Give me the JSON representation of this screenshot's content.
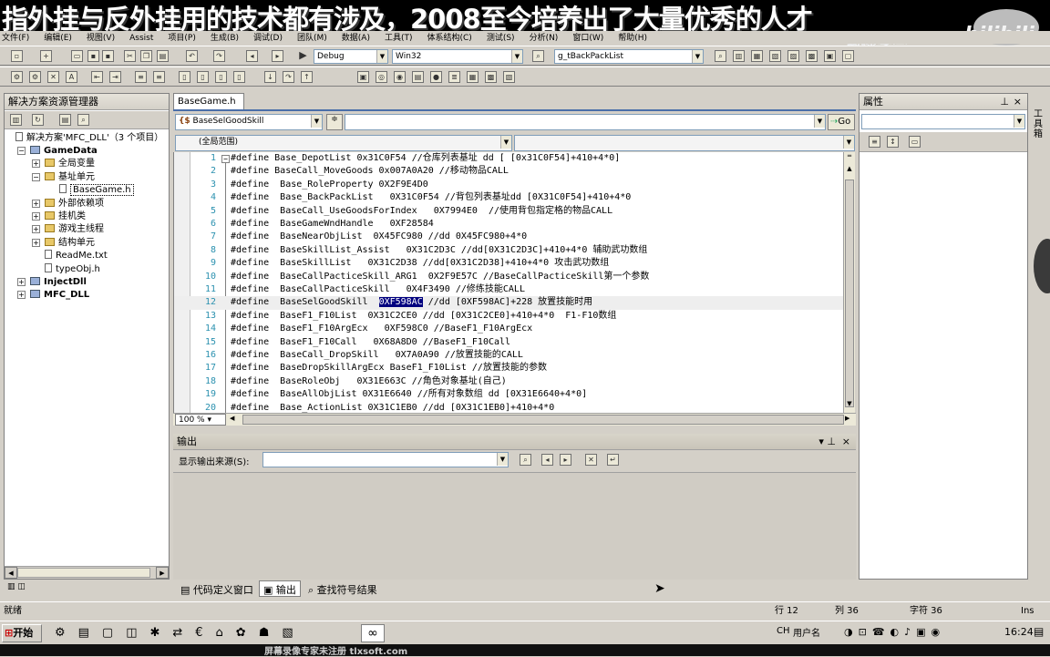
{
  "banner": {
    "text": "指外挂与反外挂用的技术都有涉及，2008至今培养出了大量优秀的人才",
    "watermark": "教你学会",
    "logo": "bilibili"
  },
  "menu": [
    "文件(F)",
    "编辑(E)",
    "视图(V)",
    "Assist",
    "项目(P)",
    "生成(B)",
    "调试(D)",
    "团队(M)",
    "数据(A)",
    "工具(T)",
    "体系结构(C)",
    "测试(S)",
    "分析(N)",
    "窗口(W)",
    "帮助(H)"
  ],
  "toolbar": {
    "config": "Debug",
    "platform": "Win32",
    "find": "g_tBackPackList"
  },
  "solution_explorer": {
    "title": "解决方案资源管理器",
    "root": "解决方案'MFC_DLL'（3 个项目）",
    "items": [
      {
        "label": "GameData",
        "indent": 1,
        "type": "project",
        "expanded": true
      },
      {
        "label": "全局变量",
        "indent": 2,
        "type": "folder",
        "expanded": false
      },
      {
        "label": "基址单元",
        "indent": 2,
        "type": "folder",
        "expanded": true
      },
      {
        "label": "BaseGame.h",
        "indent": 3,
        "type": "file",
        "selected": true
      },
      {
        "label": "外部依赖项",
        "indent": 2,
        "type": "folder",
        "expanded": false
      },
      {
        "label": "挂机类",
        "indent": 2,
        "type": "folder",
        "expanded": false
      },
      {
        "label": "游戏主线程",
        "indent": 2,
        "type": "folder",
        "expanded": false
      },
      {
        "label": "结构单元",
        "indent": 2,
        "type": "folder",
        "expanded": false
      },
      {
        "label": "ReadMe.txt",
        "indent": 2,
        "type": "file"
      },
      {
        "label": "typeObj.h",
        "indent": 2,
        "type": "file"
      },
      {
        "label": "InjectDll",
        "indent": 1,
        "type": "project",
        "expanded": false
      },
      {
        "label": "MFC_DLL",
        "indent": 1,
        "type": "project",
        "expanded": false
      }
    ]
  },
  "editor": {
    "tab": "BaseGame.h",
    "context_combo": "BaseSelGoodSkill",
    "go_label": "Go",
    "scope": "(全局范围)",
    "zoom": "100 %",
    "lines": [
      {
        "n": "1",
        "pre": "#define Base_DepotList 0x31C0F54 ",
        "cm": "//仓库列表基址 dd [ [0x31C0F54]+410+4*0]"
      },
      {
        "n": "2",
        "pre": "#define BaseCall_MoveGoods 0x007A0A20 ",
        "cm": "//移动物品CALL"
      },
      {
        "n": "3",
        "pre": "#define  Base_RoleProperty 0X2F9E4D0",
        "cm": ""
      },
      {
        "n": "4",
        "pre": "#define  Base_BackPackList   0X31C0F54 ",
        "cm": "//背包列表基址dd [0X31C0F54]+410+4*0"
      },
      {
        "n": "5",
        "pre": "#define  BaseCall_UseGoodsForIndex   0X7994E0  ",
        "cm": "//使用背包指定格的物品CALL"
      },
      {
        "n": "6",
        "pre": "#define  BaseGameWndHandle   0XF28584",
        "cm": ""
      },
      {
        "n": "7",
        "pre": "#define  BaseNearObjList  0X45FC980 ",
        "cm": "//dd 0X45FC980+4*0"
      },
      {
        "n": "8",
        "pre": "#define  BaseSkillList_Assist   0X31C2D3C ",
        "cm": "//dd[0X31C2D3C]+410+4*0 辅助武功数组"
      },
      {
        "n": "9",
        "pre": "#define  BaseSkillList   0X31C2D38 ",
        "cm": "//dd[0X31C2D38]+410+4*0 攻击武功数组"
      },
      {
        "n": "10",
        "pre": "#define  BaseCallPacticeSkill_ARG1  0X2F9E57C ",
        "cm": "//BaseCallPacticeSkill第一个参数"
      },
      {
        "n": "11",
        "pre": "#define  BaseCallPacticeSkill   0X4F3490 ",
        "cm": "//修练技能CALL"
      },
      {
        "n": "12",
        "pre": "#define  BaseSelGoodSkill  ",
        "hl": "0XF598AC",
        "cm": " //dd [0XF598AC]+228 放置技能时用"
      },
      {
        "n": "13",
        "pre": "#define  BaseF1_F10List  0X31C2CE0 ",
        "cm": "//dd [0X31C2CE0]+410+4*0  F1-F10数组"
      },
      {
        "n": "14",
        "pre": "#define  BaseF1_F10ArgEcx   0XF598C0 ",
        "cm": "//BaseF1_F10ArgEcx"
      },
      {
        "n": "15",
        "pre": "#define  BaseF1_F10Call   0X68A8D0 ",
        "cm": "//BaseF1_F10Call"
      },
      {
        "n": "16",
        "pre": "#define  BaseCall_DropSkill   0X7A0A90 ",
        "cm": "//放置技能的CALL"
      },
      {
        "n": "17",
        "pre": "#define  BaseDropSkillArgEcx BaseF1_F10List ",
        "cm": "//放置技能的参数"
      },
      {
        "n": "18",
        "pre": "#define  BaseRoleObj   0X31E663C ",
        "cm": "//角色对象基址(自己)"
      },
      {
        "n": "19",
        "pre": "#define  BaseAllObjList 0X31E6640 ",
        "cm": "//所有对象数组 dd [0X31E6640+4*0]"
      },
      {
        "n": "20",
        "pre": "#define  Base_ActionList 0X31C1EB0 ",
        "cm": "//dd [0X31C1EB0]+410+4*0"
      }
    ]
  },
  "output": {
    "title": "输出",
    "source_label": "显示输出来源(S):"
  },
  "properties": {
    "title": "属性"
  },
  "bottom_tabs": [
    "代码定义窗口",
    "输出",
    "查找符号结果"
  ],
  "status": {
    "left": "就绪",
    "row": "行 12",
    "col": "列 36",
    "char": "字符 36",
    "mode": "Ins"
  },
  "taskbar": {
    "start": "开始",
    "clock": "16:24",
    "lang": "CH",
    "user": "用户名"
  },
  "footer": "屏幕录像专家未注册 tlxsoft.com"
}
